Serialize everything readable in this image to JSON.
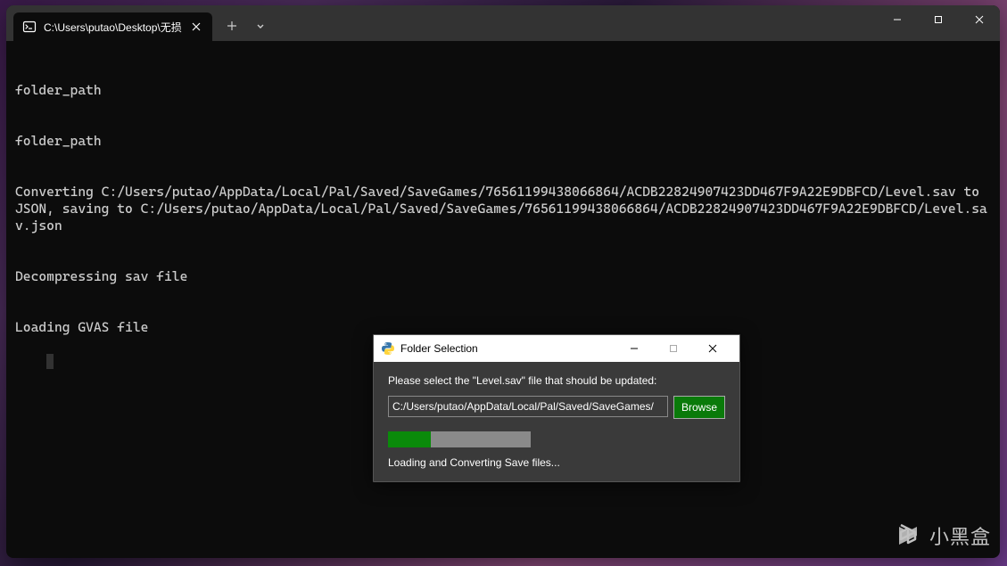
{
  "terminal": {
    "tab": {
      "title": "C:\\Users\\putao\\Desktop\\无损"
    },
    "lines": [
      "folder_path",
      "folder_path",
      "Converting C:/Users/putao/AppData/Local/Pal/Saved/SaveGames/76561199438066864/ACDB22824907423DD467F9A22E9DBFCD/Level.sav to JSON, saving to C:/Users/putao/AppData/Local/Pal/Saved/SaveGames/76561199438066864/ACDB22824907423DD467F9A22E9DBFCD/Level.sav.json",
      "Decompressing sav file",
      "Loading GVAS file"
    ]
  },
  "dialog": {
    "title": "Folder Selection",
    "prompt": "Please select the \"Level.sav\" file that should be updated:",
    "input_value": "C:/Users/putao/AppData/Local/Pal/Saved/SaveGames/",
    "browse_label": "Browse",
    "status": "Loading and Converting Save files...",
    "progress_percent": 30
  },
  "watermark": {
    "text": "小黑盒"
  },
  "colors": {
    "terminal_bg": "#0c0c0c",
    "titlebar_bg": "#333333",
    "dialog_bg": "#3a3a3a",
    "accent_green": "#0a8a0a"
  }
}
